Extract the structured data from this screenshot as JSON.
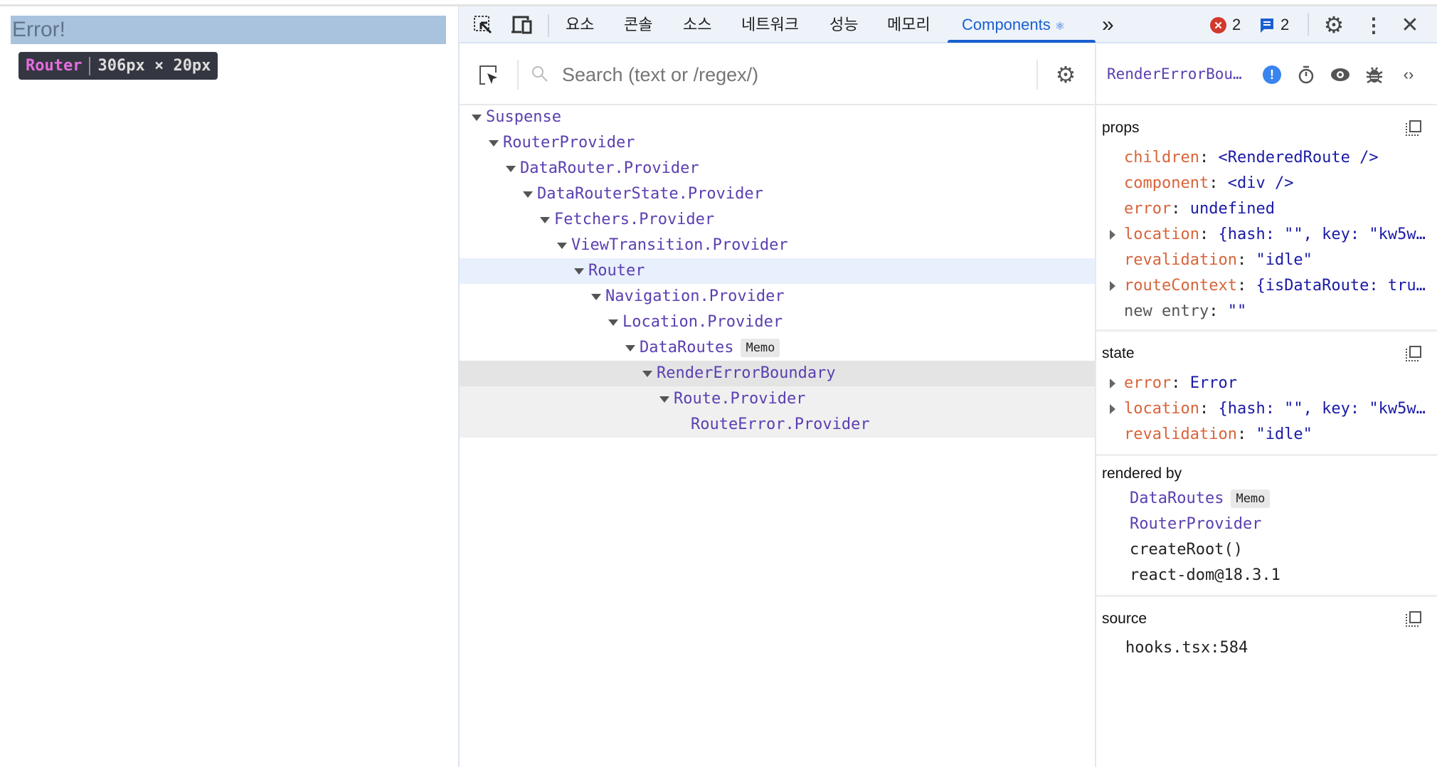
{
  "page": {
    "error_text": "Error!",
    "tooltip": {
      "name": "Router",
      "size": "306px × 20px"
    }
  },
  "toolbar": {
    "tabs": [
      {
        "label": "요소"
      },
      {
        "label": "콘솔"
      },
      {
        "label": "소스"
      },
      {
        "label": "네트워크"
      },
      {
        "label": "성능"
      },
      {
        "label": "메모리"
      },
      {
        "label": "Components",
        "active": true
      }
    ],
    "more": "»",
    "error_count": "2",
    "message_count": "2",
    "icons": [
      "inspect-element-icon",
      "device-toolbar-icon",
      "react-icon",
      "error-icon",
      "message-icon",
      "settings-icon",
      "more-vertical-icon",
      "close-icon"
    ]
  },
  "tree": {
    "search_placeholder": "Search (text or /regex/)",
    "nodes": [
      {
        "name": "Suspense",
        "depth": 0
      },
      {
        "name": "RouterProvider",
        "depth": 1
      },
      {
        "name": "DataRouter.Provider",
        "depth": 2
      },
      {
        "name": "DataRouterState.Provider",
        "depth": 3
      },
      {
        "name": "Fetchers.Provider",
        "depth": 4
      },
      {
        "name": "ViewTransition.Provider",
        "depth": 5
      },
      {
        "name": "Router",
        "depth": 6,
        "selected": true
      },
      {
        "name": "Navigation.Provider",
        "depth": 7
      },
      {
        "name": "Location.Provider",
        "depth": 8
      },
      {
        "name": "DataRoutes",
        "depth": 9,
        "badge": "Memo"
      },
      {
        "name": "RenderErrorBoundary",
        "depth": 10,
        "hovered": true
      },
      {
        "name": "Route.Provider",
        "depth": 11,
        "hover_child": true
      },
      {
        "name": "RouteError.Provider",
        "depth": 12,
        "hover_child": true,
        "leaf": true
      }
    ]
  },
  "inspector": {
    "title": "RenderErrorBou…",
    "props_label": "props",
    "props": [
      {
        "key": "children",
        "value": "<RenderedRoute />"
      },
      {
        "key": "component",
        "value": "<div />"
      },
      {
        "key": "error",
        "value": " undefined"
      },
      {
        "key": "location",
        "value": "{hash: \"\", key: \"kw5w…",
        "expandable": true
      },
      {
        "key": "revalidation",
        "value": " \"idle\""
      },
      {
        "key": "routeContext",
        "value": "{isDataRoute: tru…",
        "expandable": true
      },
      {
        "key": "new entry",
        "value": " \"\"",
        "muted": true
      }
    ],
    "state_label": "state",
    "state": [
      {
        "key": "error",
        "value": "Error",
        "expandable": true
      },
      {
        "key": "location",
        "value": "{hash: \"\", key: \"kw5w…",
        "expandable": true
      },
      {
        "key": "revalidation",
        "value": " \"idle\""
      }
    ],
    "rendered_by_label": "rendered by",
    "rendered_by": [
      {
        "name": "DataRoutes",
        "badge": "Memo",
        "link": true
      },
      {
        "name": "RouterProvider",
        "link": true
      },
      {
        "name": "createRoot()"
      },
      {
        "name": "react-dom@18.3.1"
      }
    ],
    "source_label": "source",
    "source": "hooks.tsx:584"
  },
  "colors": {
    "accent": "#1a5fd0",
    "component_name": "#5b3fb0",
    "prop_key": "#d8643a",
    "prop_value": "#1a1aa6",
    "selected_row": "#e8f0fe",
    "hovered_row": "#e4e4e4"
  }
}
